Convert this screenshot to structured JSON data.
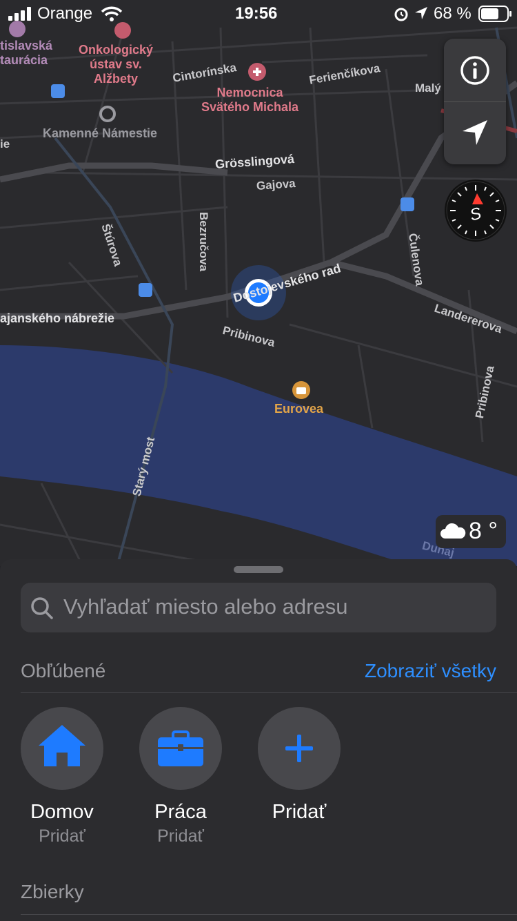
{
  "status_bar": {
    "carrier": "Orange",
    "time": "19:56",
    "battery": "68 %"
  },
  "map": {
    "labels": {
      "tislavska": "tislavská\ntaurácia",
      "onkologicky": "Onkologický\nústav sv.\nAlžbety",
      "cintorinska": "Cintorínska",
      "nemocnica": "Nemocnica\nSvätého Michala",
      "feriencikova": "Ferienčíkova",
      "maly": "Malý",
      "kamenne": "Kamenné Námestie",
      "ie": "ie",
      "grosslingova": "Grösslingová",
      "gajova": "Gajova",
      "sturova": "Štúrova",
      "bezrucova": "Bezručova",
      "culenova": "Čulenova",
      "dostojevskeho": "Dostojevského rad",
      "landererova": "Landererova",
      "nabrezie": "ajanského nábrežie",
      "pribinova1": "Pribinova",
      "pribinova2": "Pribinova",
      "eurovea": "Eurovea",
      "stary_most": "Starý most",
      "dunaj": "Dunaj"
    },
    "compass_letter": "S"
  },
  "weather": {
    "temp": "8 °"
  },
  "sheet": {
    "search_placeholder": "Vyhľadať miesto alebo adresu",
    "favorites_title": "Obľúbené",
    "show_all": "Zobraziť všetky",
    "favorites": [
      {
        "label": "Domov",
        "sub": "Pridať"
      },
      {
        "label": "Práca",
        "sub": "Pridať"
      },
      {
        "label": "Pridať",
        "sub": ""
      }
    ],
    "collections_title": "Zbierky"
  },
  "colors": {
    "accent": "#2e8fff",
    "water": "#2c3a6b",
    "map_bg": "#2a2a2d"
  }
}
